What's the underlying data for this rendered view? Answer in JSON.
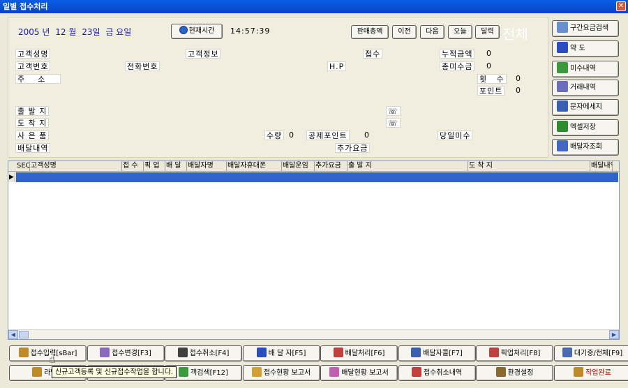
{
  "window": {
    "title": "일별 접수처리",
    "close_glyph": "✕"
  },
  "date": {
    "year": "2005 년",
    "month": "12 월",
    "day": "23일",
    "weekday": "금 요일"
  },
  "toolbar": {
    "now_btn": "현재시간",
    "time": "14:57:39",
    "sales_total_btn": "판매총액",
    "prev_btn": "이전",
    "next_btn": "다음",
    "today_btn": "오늘",
    "calendar_btn": "달력",
    "ghost_text": "전체"
  },
  "fields": {
    "customer_name": "고객성명",
    "customer_info": "고객정보",
    "receipt": "접수",
    "accum_amount": "누적금액",
    "accum_amount_val": "0",
    "customer_no": "고객번호",
    "phone": "전화번호",
    "hp": "H.P",
    "total_unpaid": "총미수금",
    "total_unpaid_val": "0",
    "address": "주    소",
    "count": "횟   수",
    "count_val": "0",
    "point": "포인트",
    "point_val": "0",
    "origin": "출 발 지",
    "destination": "도 착 지",
    "tel_glyph_1": "☏",
    "tel_glyph_2": "☏",
    "item": "사 은 품",
    "qty": "수량",
    "qty_val": "0",
    "deduct_point": "공제포인트",
    "deduct_point_val": "0",
    "today_unpaid": "당일미수",
    "delivery_detail": "배달내역",
    "extra_charge": "추가요금"
  },
  "side_buttons": [
    {
      "label": "구간요금검색",
      "icon": "search-people-icon",
      "color": "#6a8fd0"
    },
    {
      "label": "약  도",
      "icon": "map-icon",
      "color": "#2a4ec0"
    },
    {
      "label": "미수내역",
      "icon": "money-bag-icon",
      "color": "#3c9a3c"
    },
    {
      "label": "거래내역",
      "icon": "receipt-icon",
      "color": "#6c6cc0"
    },
    {
      "label": "문자메세지",
      "icon": "message-icon",
      "color": "#3a5fb0"
    },
    {
      "label": "엑셀저장",
      "icon": "excel-icon",
      "color": "#2e8b2e"
    },
    {
      "label": "배달자조회",
      "icon": "people-icon",
      "color": "#4068c0"
    }
  ],
  "grid": {
    "columns": [
      "SEQ",
      "고객성명",
      "접 수",
      "픽 업",
      "배 달",
      "배달자명",
      "배달자휴대폰",
      "배달운임",
      "추가요금",
      "출 발 지",
      "도 착 지",
      "배달내역"
    ],
    "row_indicator": "▶",
    "scroll_left": "◀",
    "scroll_right": "▶"
  },
  "bottom_row1": [
    {
      "label": "접수입력[sBar]",
      "icon": "entry-icon",
      "color": "#c08a2a"
    },
    {
      "label": "접수변경[F3]",
      "icon": "edit-icon",
      "color": "#8a6ac0"
    },
    {
      "label": "접수취소[F4]",
      "icon": "disk-cancel-icon",
      "color": "#404040"
    },
    {
      "label": "배 달 자[F5]",
      "icon": "person-icon",
      "color": "#2a4ec0"
    },
    {
      "label": "배달처리[F6]",
      "icon": "process-icon",
      "color": "#c04040"
    },
    {
      "label": "배달자콜[F7]",
      "icon": "call-icon",
      "color": "#3a5fb0"
    },
    {
      "label": "픽업처리[F8]",
      "icon": "pickup-icon",
      "color": "#c04040"
    },
    {
      "label": "대기중/전체[F9]",
      "icon": "list-icon",
      "color": "#4a6ab0"
    }
  ],
  "bottom_row2": [
    {
      "label": "라벨출",
      "icon": "printer-icon",
      "color": "#c08a2a"
    },
    {
      "label": "",
      "icon": "blank-icon",
      "color": "#a0a0a0"
    },
    {
      "label": "객검색[F12]",
      "icon": "search-icon",
      "color": "#3c9a3c"
    },
    {
      "label": "접수현황 보고서",
      "icon": "report-icon",
      "color": "#d0a030"
    },
    {
      "label": "배달현황 보고서",
      "icon": "report2-icon",
      "color": "#c060b0"
    },
    {
      "label": "접수취소내역",
      "icon": "cancel-list-icon",
      "color": "#c04040"
    },
    {
      "label": "환경설정",
      "icon": "settings-icon",
      "color": "#8a6a30"
    },
    {
      "label": "작업완료",
      "icon": "exit-door-icon",
      "color": "#c08a2a",
      "text_color": "#cc0000"
    }
  ],
  "tooltip": {
    "text": "신규고객등록 및 신규접수작업을 합니다."
  }
}
